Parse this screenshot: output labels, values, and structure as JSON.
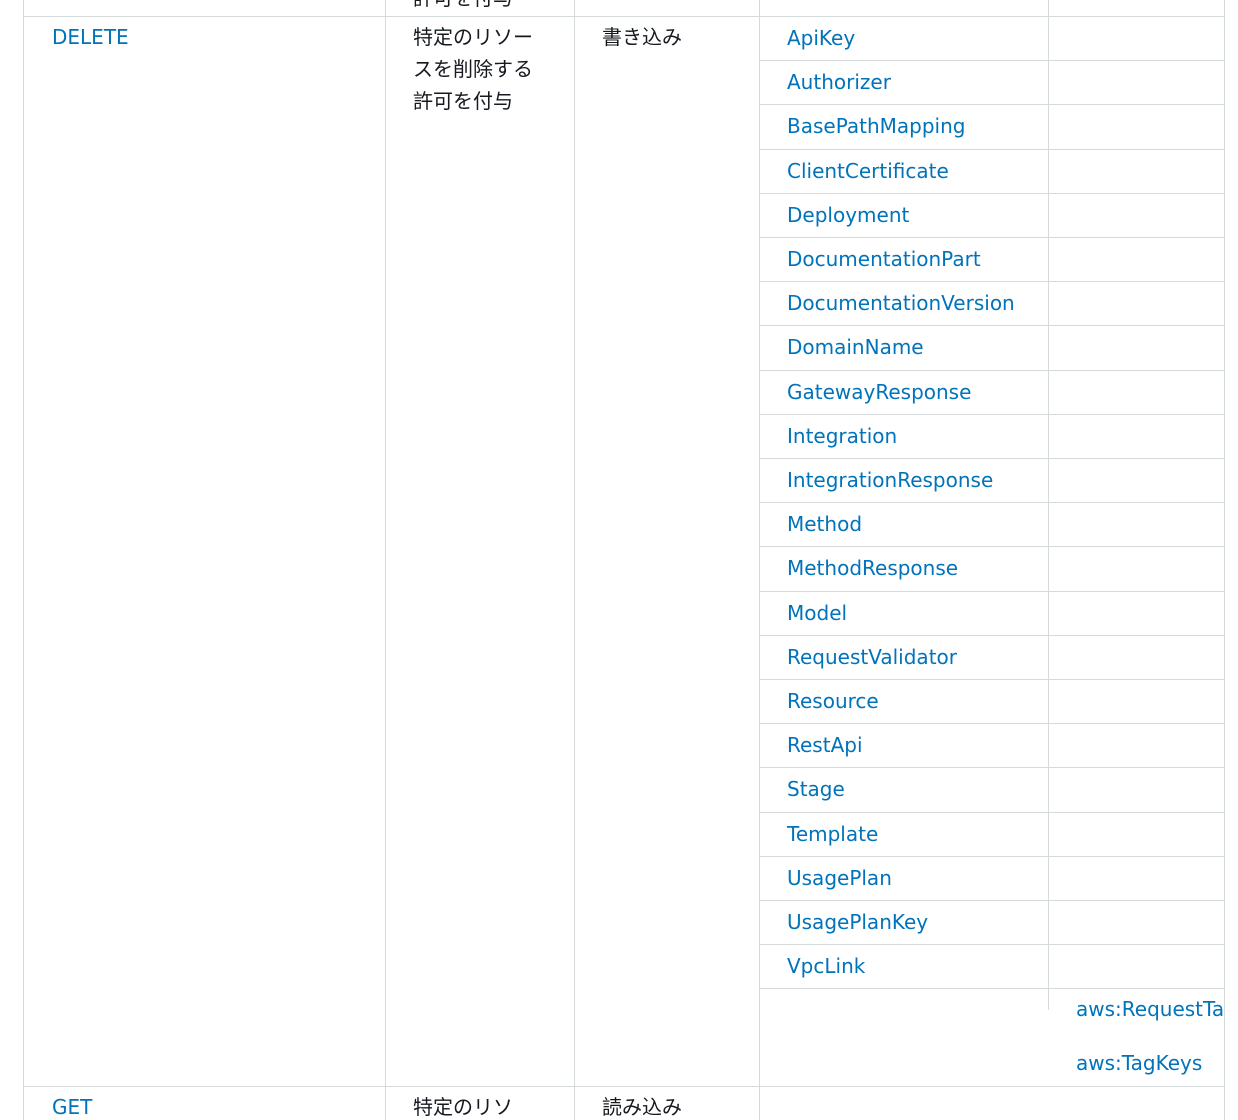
{
  "row": {
    "action": "DELETE",
    "description": "特定のリソースを削除する許可を付与",
    "access_level": "書き込み",
    "resource_types": [
      "ApiKey",
      "Authorizer",
      "BasePathMapping",
      "ClientCertificate",
      "Deployment",
      "DocumentationPart",
      "DocumentationVersion",
      "DomainName",
      "GatewayResponse",
      "Integration",
      "IntegrationResponse",
      "Method",
      "MethodResponse",
      "Model",
      "RequestValidator",
      "Resource",
      "RestApi",
      "Stage",
      "Template",
      "UsagePlan",
      "UsagePlanKey",
      "VpcLink"
    ],
    "condition_keys": [
      "aws:RequestTag",
      "aws:TagKeys"
    ]
  },
  "colors": {
    "link": "#0073bb",
    "text": "#16191f",
    "border": "#d5dbdb"
  }
}
